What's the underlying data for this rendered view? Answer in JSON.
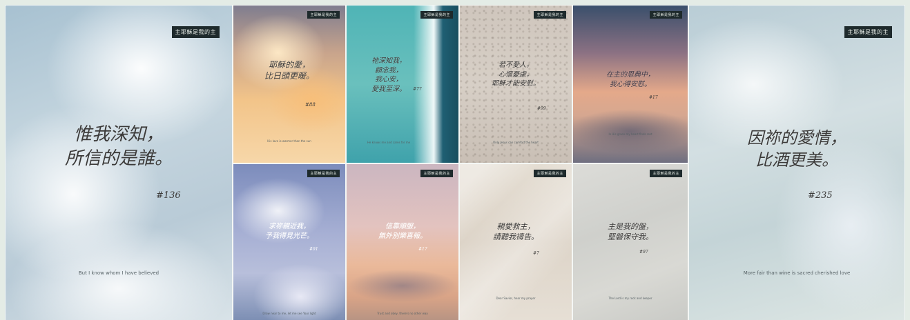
{
  "cards": [
    {
      "id": "left-big",
      "tag": "主耶穌是我的主",
      "verse": [
        "惟我深知，",
        "所信的是誰。"
      ],
      "ref": "#136",
      "caption": "But I know whom I have believed"
    },
    {
      "id": "peach-clouds",
      "tag": "主耶穌是我的主",
      "verse": [
        "耶穌的愛，",
        "比日頭更暖。"
      ],
      "ref": "#88",
      "caption": "His love is warmer than the sun"
    },
    {
      "id": "sea",
      "tag": "主耶穌是我的主",
      "verse": [
        "祂深知我，",
        "顧念我，",
        "我心安，",
        "愛我至深。"
      ],
      "ref": "#77",
      "caption": "He knows me and cares for me"
    },
    {
      "id": "pebble",
      "tag": "主耶穌是我的主",
      "verse": [
        "若不愛人，",
        "心懷憂慮，",
        "耶穌才能安慰。"
      ],
      "ref": "#99",
      "caption": "Only Jesus can comfort the heart"
    },
    {
      "id": "sunset",
      "tag": "主耶穌是我的主",
      "verse": [
        "在主的恩典中，",
        "我心得安慰。"
      ],
      "ref": "#17",
      "caption": "In His grace my heart finds rest"
    },
    {
      "id": "lilac-clouds",
      "tag": "主耶穌是我的主",
      "verse": [
        "求祢親近我，",
        "予我得見光芒。"
      ],
      "ref": "#91",
      "caption": "Draw near to me, let me see Your light"
    },
    {
      "id": "dusk-pink",
      "tag": "主耶穌是我的主",
      "verse": [
        "信靠順服，",
        "無外別樂喜報。"
      ],
      "ref": "#17",
      "caption": "Trust and obey, there's no other way"
    },
    {
      "id": "sand",
      "tag": "主耶穌是我的主",
      "verse": [
        "親愛救主，",
        "請聽我禱告。"
      ],
      "ref": "#7",
      "caption": "Dear Savior, hear my prayer"
    },
    {
      "id": "grey",
      "tag": "主耶穌是我的主",
      "verse": [
        "主是我的盤，",
        "堅磐保守我。"
      ],
      "ref": "#97",
      "caption": "The Lord is my rock and keeper"
    },
    {
      "id": "right-big",
      "tag": "主耶穌是我的主",
      "verse": [
        "因祢的愛情，",
        "比酒更美。"
      ],
      "ref": "#235",
      "caption": "More fair than wine is sacred cherished love"
    }
  ]
}
